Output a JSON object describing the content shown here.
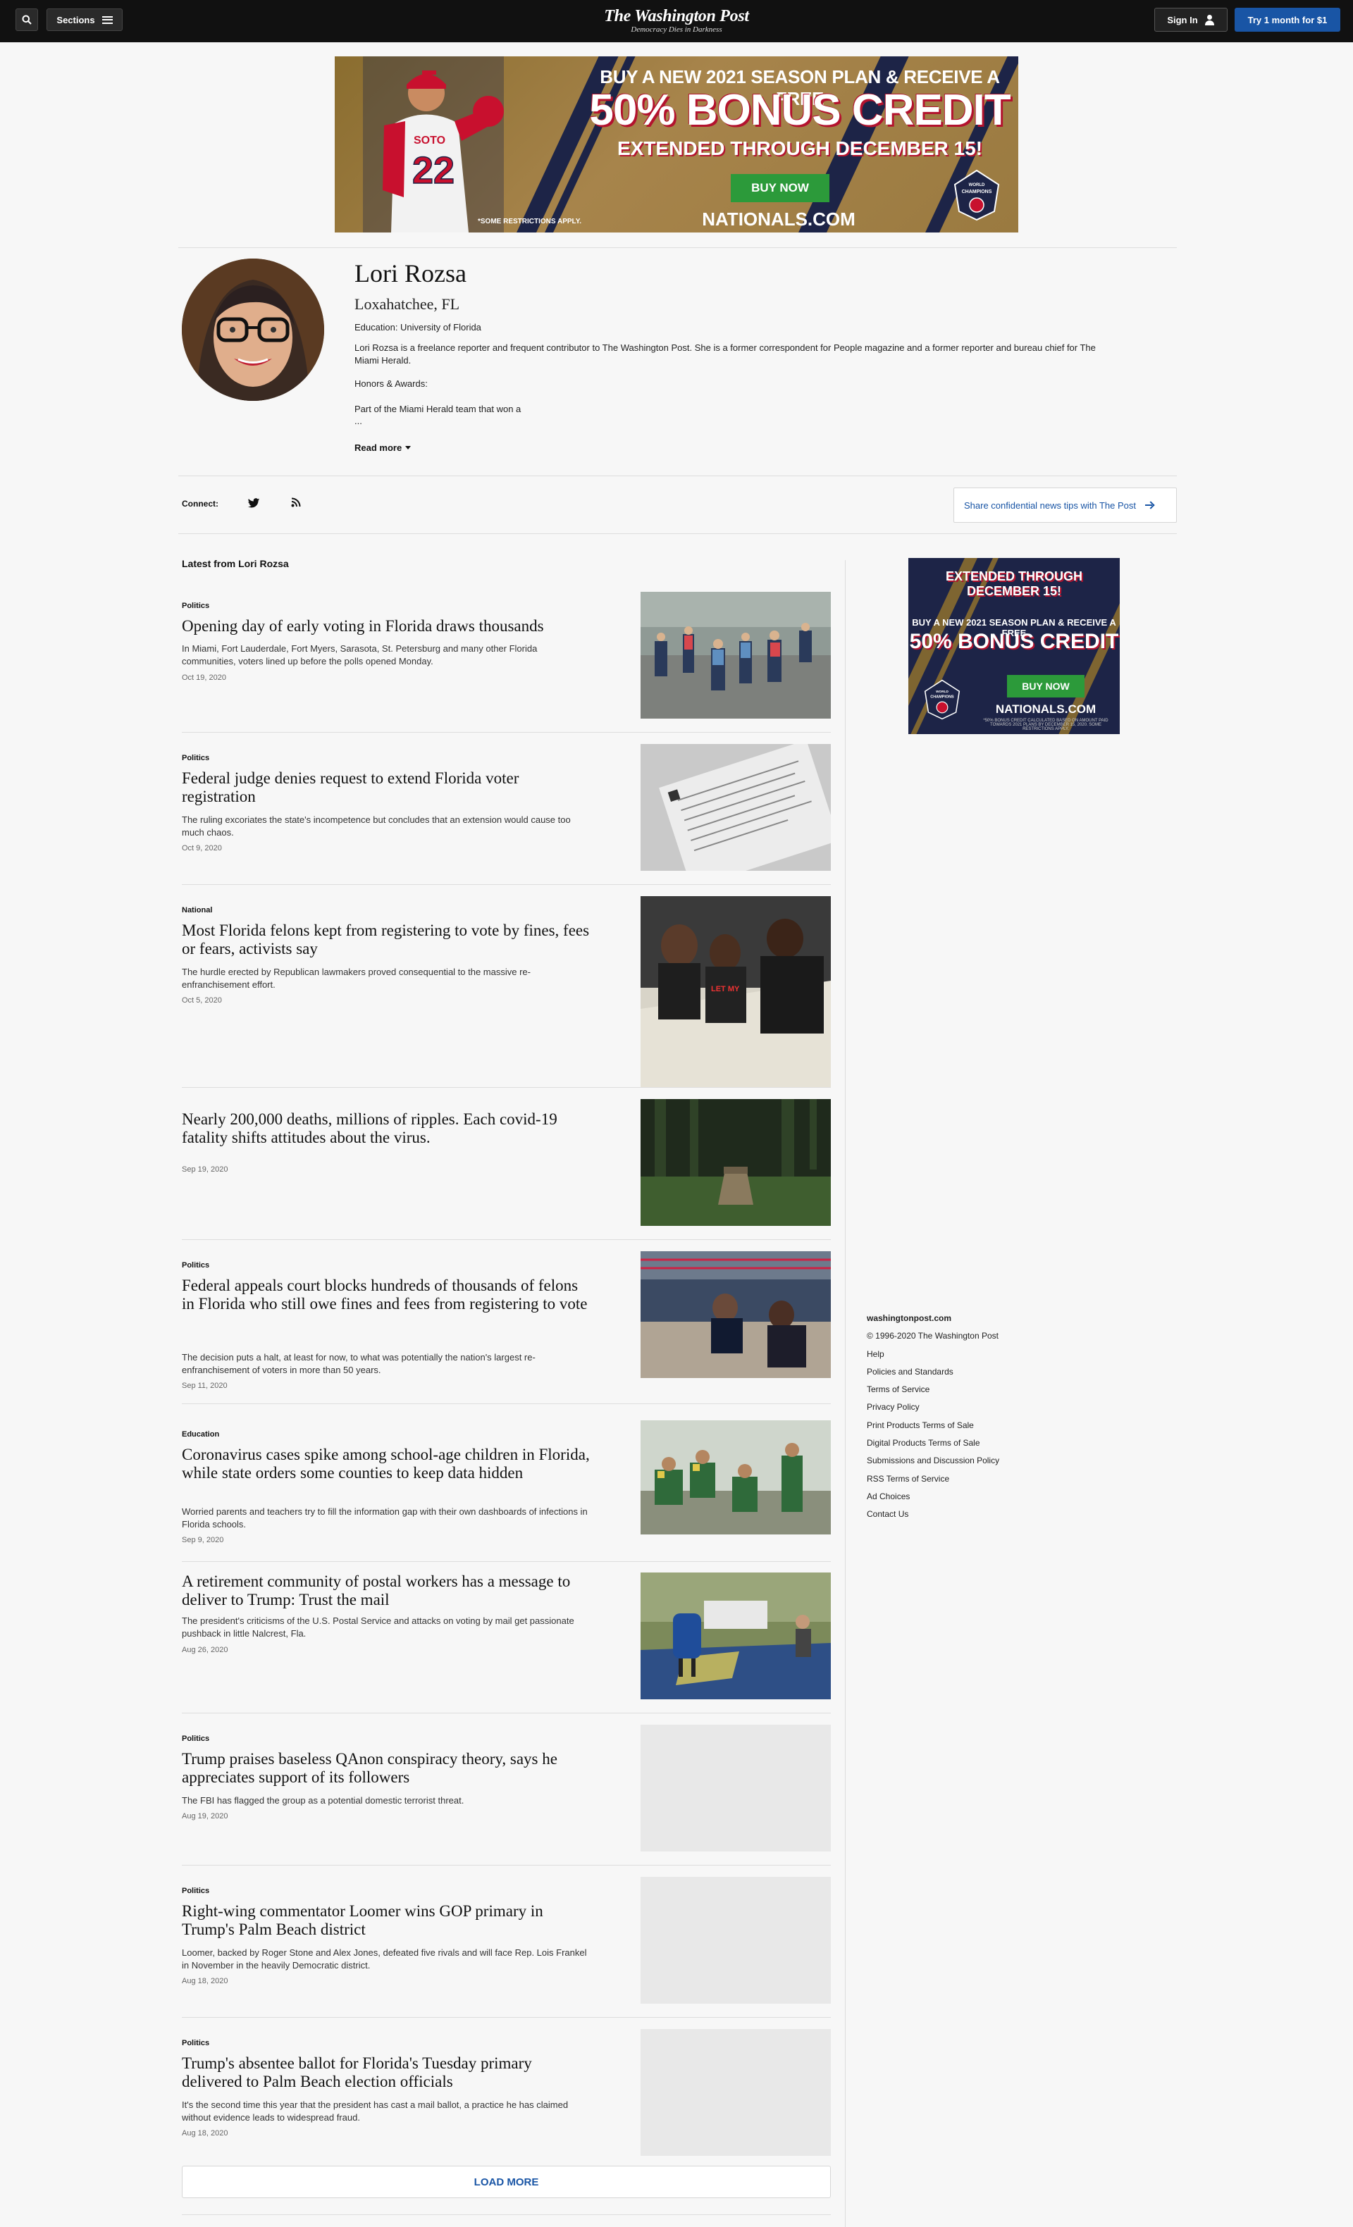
{
  "topbar": {
    "sections_label": "Sections",
    "logo": "The Washington Post",
    "tagline": "Democracy Dies in Darkness",
    "signin_label": "Sign In",
    "subscribe_label": "Try 1 month for $1"
  },
  "ad_top": {
    "line1": "BUY A NEW 2021 SEASON PLAN & RECEIVE A FREE",
    "line2": "50% BONUS CREDIT",
    "line3": "EXTENDED THROUGH DECEMBER 15!",
    "cta": "BUY NOW",
    "url": "NATIONALS.COM",
    "restrictions": "*SOME RESTRICTIONS APPLY.",
    "jersey_name": "SOTO",
    "jersey_number": "22",
    "badge": "WORLD CHAMPIONS"
  },
  "profile": {
    "name": "Lori Rozsa",
    "location": "Loxahatchee, FL",
    "education": "Education: University of Florida",
    "bio": "Lori Rozsa is a freelance reporter and frequent contributor to The Washington Post. She is a former correspondent for People magazine and a former reporter and bureau chief for The Miami Herald.",
    "honors_label": "Honors & Awards:",
    "honors_text": "Part of the Miami Herald team that won a",
    "ellipsis": "...",
    "read_more": "Read more"
  },
  "connect": {
    "label": "Connect:",
    "icons": [
      "twitter-icon",
      "rss-icon"
    ],
    "tips_label": "Share confidential news tips with The Post"
  },
  "latest_heading": "Latest from Lori Rozsa",
  "articles": [
    {
      "kicker": "Politics",
      "headline": "Opening day of early voting in Florida draws thousands",
      "blurb": "In Miami, Fort Lauderdale, Fort Myers, Sarasota, St. Petersburg and many other Florida communities, voters lined up before the polls opened Monday.",
      "date": "Oct 19, 2020"
    },
    {
      "kicker": "Politics",
      "headline": "Federal judge denies request to extend Florida voter registration",
      "blurb": "The ruling excoriates the state's incompetence but concludes that an extension would cause too much chaos.",
      "date": "Oct 9, 2020"
    },
    {
      "kicker": "National",
      "headline": "Most Florida felons kept from registering to vote by fines, fees or fears, activists say",
      "blurb": "The hurdle erected by Republican lawmakers proved consequential to the massive re-enfranchisement effort.",
      "date": "Oct 5, 2020"
    },
    {
      "kicker": "",
      "headline": "Nearly 200,000 deaths, millions of ripples. Each covid-19 fatality shifts attitudes about the virus.",
      "blurb": "",
      "date": "Sep 19, 2020"
    },
    {
      "kicker": "Politics",
      "headline": "Federal appeals court blocks hundreds of thousands of felons in Florida who still owe fines and fees from registering to vote",
      "blurb": "The decision puts a halt, at least for now, to what was potentially the nation's largest re-enfranchisement of voters in more than 50 years.",
      "date": "Sep 11, 2020"
    },
    {
      "kicker": "Education",
      "headline": "Coronavirus cases spike among school-age children in Florida, while state orders some counties to keep data hidden",
      "blurb": "Worried parents and teachers try to fill the information gap with their own dashboards of infections in Florida schools.",
      "date": "Sep 9, 2020"
    },
    {
      "kicker": "",
      "headline": "A retirement community of postal workers has a message to deliver to Trump: Trust the mail",
      "blurb": "The president's criticisms of the U.S. Postal Service and attacks on voting by mail get passionate pushback in little Nalcrest, Fla.",
      "date": "Aug 26, 2020"
    },
    {
      "kicker": "Politics",
      "headline": "Trump praises baseless QAnon conspiracy theory, says he appreciates support of its followers",
      "blurb": "The FBI has flagged the group as a potential domestic terrorist threat.",
      "date": "Aug 19, 2020"
    },
    {
      "kicker": "Politics",
      "headline": "Right-wing commentator Loomer wins GOP primary in Trump's Palm Beach district",
      "blurb": "Loomer, backed by Roger Stone and Alex Jones, defeated five rivals and will face Rep. Lois Frankel in November in the heavily Democratic district.",
      "date": "Aug 18, 2020"
    },
    {
      "kicker": "Politics",
      "headline": "Trump's absentee ballot for Florida's Tuesday primary delivered to Palm Beach election officials",
      "blurb": "It's the second time this year that the president has cast a mail ballot, a practice he has claimed without evidence leads to widespread fraud.",
      "date": "Aug 18, 2020"
    }
  ],
  "load_more": "LOAD MORE",
  "ad_side": {
    "line1": "EXTENDED THROUGH",
    "line1b": "DECEMBER 15!",
    "line2": "BUY A NEW 2021 SEASON PLAN & RECEIVE A FREE",
    "line3": "50% BONUS CREDIT",
    "cta": "BUY NOW",
    "url": "NATIONALS.COM",
    "fine": "*50% BONUS CREDIT CALCULATED BASED ON AMOUNT PAID TOWARDS 2021 PLANS BY DECEMBER 15, 2020. SOME RESTRICTIONS APPLY.",
    "badge": "WORLD CHAMPIONS"
  },
  "footer": {
    "site": "washingtonpost.com",
    "copyright": "© 1996-2020 The Washington Post",
    "links": [
      "Help",
      "Policies and Standards",
      "Terms of Service",
      "Privacy Policy",
      "Print Products Terms of Sale",
      "Digital Products Terms of Sale",
      "Submissions and Discussion Policy",
      "RSS Terms of Service",
      "Ad Choices",
      "Contact Us"
    ]
  },
  "colors": {
    "accent": "#1955a5",
    "topbar": "#111111",
    "page_bg": "#f7f7f7",
    "ad_navy": "#1d2447",
    "ad_gold": "#8a6d2f",
    "ad_red": "#b3122e",
    "ad_green": "#2c9a3a"
  }
}
